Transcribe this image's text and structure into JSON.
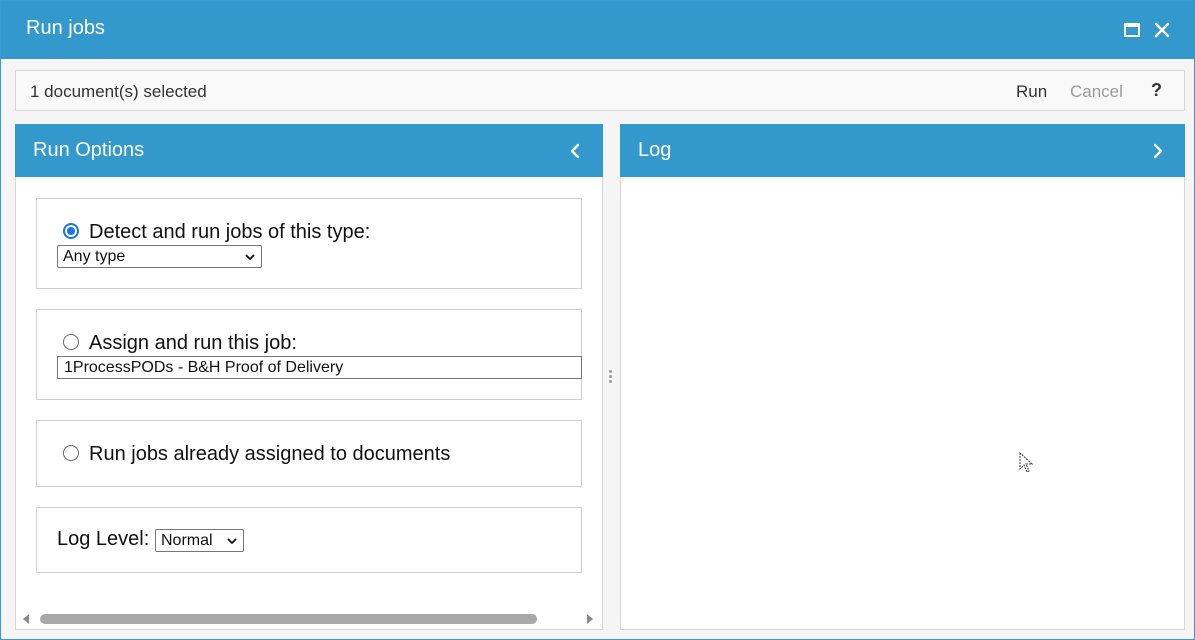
{
  "window": {
    "title": "Run jobs",
    "icons": {
      "maximize": "maximize-icon",
      "close": "close-icon"
    }
  },
  "toolbar": {
    "selection_text": "1 document(s) selected",
    "run_label": "Run",
    "cancel_label": "Cancel",
    "help_label": "?"
  },
  "left_panel": {
    "title": "Run Options",
    "collapse_icon": "chevron-left-icon",
    "options": {
      "detect": {
        "label": "Detect and run jobs of this type:",
        "checked": true,
        "select_value": "Any type"
      },
      "assign": {
        "label": "Assign and run this job:",
        "checked": false,
        "job_value": "1ProcessPODs - B&H Proof of Delivery"
      },
      "already": {
        "label": "Run jobs already assigned to documents",
        "checked": false
      },
      "log_level": {
        "label": "Log Level:",
        "select_value": "Normal"
      }
    }
  },
  "right_panel": {
    "title": "Log",
    "expand_icon": "chevron-right-icon"
  },
  "colors": {
    "header_blue": "#3399cc",
    "radio_accent": "#1a73e8",
    "disabled_text": "#999999"
  }
}
